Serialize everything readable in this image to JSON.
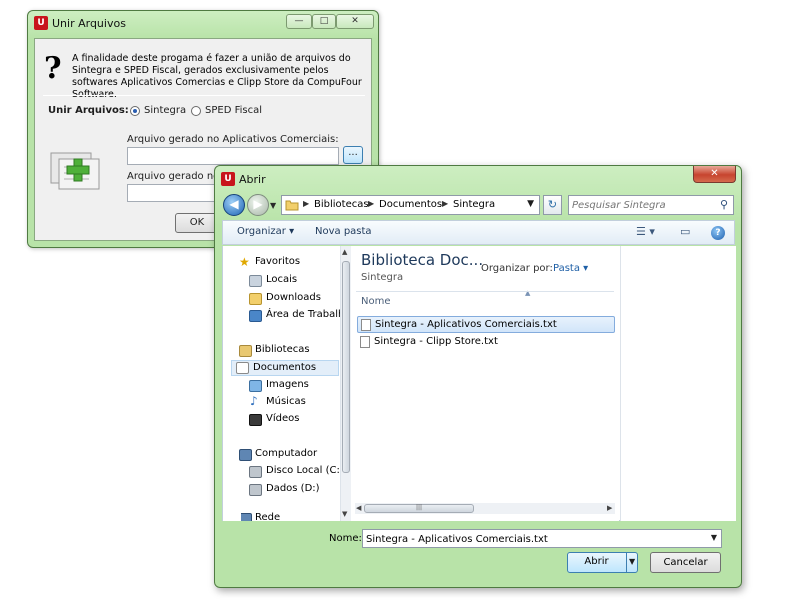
{
  "unir_window": {
    "title": "Unir Arquivos",
    "icon": "compufour-logo-icon",
    "description": "A finalidade deste progama é fazer a união de arquivos do Sintegra e SPED Fiscal, gerados exclusivamente pelos softwares Aplicativos Comercias e Clipp Store da CompuFour Software.",
    "unir_label": "Unir Arquivos:",
    "option_sintegra": "Sintegra",
    "option_sped": "SPED Fiscal",
    "selected_option": "Sintegra",
    "field1_label": "Arquivo gerado no Aplicativos Comerciais:",
    "field1_value": "",
    "browse_label": "...",
    "field2_label": "Arquivo gerado no Clip",
    "field2_value": "",
    "ok_label": "OK"
  },
  "abrir_window": {
    "title": "Abrir",
    "close_label": "✕",
    "breadcrumb": [
      "Bibliotecas",
      "Documentos",
      "Sintegra"
    ],
    "search_placeholder": "Pesquisar Sintegra",
    "toolbar": {
      "organize": "Organizar ▾",
      "new_folder": "Nova pasta"
    },
    "sidebar": {
      "favorites": "Favoritos",
      "favorites_items": [
        "Locais",
        "Downloads",
        "Área de Trabalho"
      ],
      "libraries": "Bibliotecas",
      "libraries_items": [
        "Documentos",
        "Imagens",
        "Músicas",
        "Vídeos"
      ],
      "selected": "Documentos",
      "computer": "Computador",
      "computer_items": [
        "Disco Local (C:)",
        "Dados (D:)"
      ],
      "network_partial": "Rede"
    },
    "library_title": "Biblioteca Doc...",
    "library_subtitle": "Sintegra",
    "arrange_label": "Organizar por:",
    "arrange_value": "Pasta ▾",
    "column_name": "Nome",
    "files": [
      {
        "name": "Sintegra - Aplicativos Comerciais.txt",
        "selected": true
      },
      {
        "name": "Sintegra - Clipp Store.txt",
        "selected": false
      }
    ],
    "filename_label": "Nome:",
    "filename_value": "Sintegra - Aplicativos Comerciais.txt",
    "open_label": "Abrir",
    "cancel_label": "Cancelar"
  },
  "colors": {
    "frame": "#b8e3a8",
    "accent": "#1e5fa6",
    "selection": "#d1e5fa"
  }
}
